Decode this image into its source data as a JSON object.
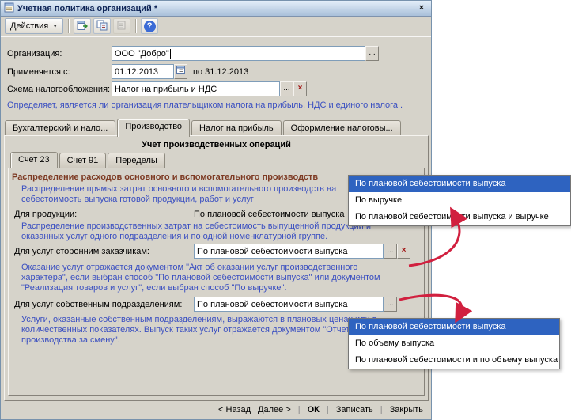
{
  "window": {
    "title": "Учетная политика организаций *"
  },
  "icons": {
    "dropdown": "▼",
    "close": "×",
    "ellipsis": "...",
    "clear": "×",
    "help": "?"
  },
  "toolbar": {
    "actions_label": "Действия"
  },
  "form": {
    "org_label": "Организация:",
    "org_value": "ООО \"Добро\"",
    "applies_label": "Применяется с:",
    "applies_from": "01.12.2013",
    "applies_to": "по 31.12.2013",
    "tax_scheme_label": "Схема налогообложения:",
    "tax_scheme_value": "Налог на прибыль и НДС",
    "tax_hint": "Определяет, является ли организация плательщиком налога на прибыль, НДС и единого налога ."
  },
  "tabs": [
    "Бухгалтерский и нало...",
    "Производство",
    "Налог на прибыль",
    "Оформление налоговы..."
  ],
  "production": {
    "group_title": "Учет производственных операций",
    "subtabs": [
      "Счет 23",
      "Счет 91",
      "Переделы"
    ],
    "heading": "Распределение расходов основного и вспомогательного производств",
    "hint1": "Распределение прямых затрат основного и вспомогательного производств на себестоимость выпуска готовой продукции, работ и услуг",
    "for_products_label": "Для продукции:",
    "for_products_value": "По плановой себестоимости выпуска",
    "hint2": "Распределение производственных затрат на себестоимость выпущенной продукции и оказанных услуг одного подразделения и по одной номенклатурной группе.",
    "for_third_label": "Для услуг сторонним заказчикам:",
    "for_third_value": "По плановой себестоимости выпуска",
    "hint3": "Оказание услуг отражается документом \"Акт об оказании услуг производственного характера\", если выбран способ \"По плановой себестоимости выпуска\" или документом \"Реализация товаров и услуг\", если выбран способ \"По выручке\".",
    "for_own_label": "Для услуг собственным подразделениям:",
    "for_own_value": "По плановой себестоимости выпуска",
    "hint4": "Услуги, оказанные собственным подразделениям, выражаются в плановых ценах или в количественных показателях. Выпуск таких услуг отражается документом \"Отчет производства за смену\"."
  },
  "dropdown1": {
    "selected_index": 0,
    "items": [
      "По плановой себестоимости выпуска",
      "По выручке",
      "По плановой себестоимости выпуска и выручке"
    ]
  },
  "dropdown2": {
    "selected_index": 0,
    "items": [
      "По плановой себестоимости выпуска",
      "По объему выпуска",
      "По плановой себестоимости и по объему выпуска"
    ]
  },
  "footer": {
    "back": "< Назад",
    "next": "Далее >",
    "ok": "ОК",
    "save": "Записать",
    "close": "Закрыть",
    "sep": "|"
  },
  "colors": {
    "selection": "#2e63c0",
    "hint_text": "#3a4fc1",
    "section_heading": "#7d3a23",
    "annotation_arrow": "#d1203f",
    "window_background": "#d6d3ca"
  }
}
